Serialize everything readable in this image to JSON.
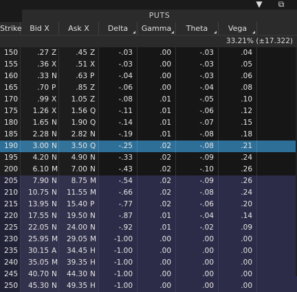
{
  "section_title": "PUTS",
  "headers": {
    "strike": "Strike",
    "bid": "Bid X",
    "ask": "Ask X",
    "delta": "Delta",
    "gamma": "Gamma",
    "theta": "Theta",
    "vega": "Vega"
  },
  "summary": "33.21% (±17.322)",
  "icons": {
    "dropdown": "layers-down-icon",
    "popout": "popout-window-icon"
  },
  "colors": {
    "itm_row": "#2d2c48",
    "selected_row": "#2d6f96",
    "otm_row": "#161616"
  },
  "rows": [
    {
      "strike": "150",
      "bid": ".27",
      "bidx": "Z",
      "ask": ".45",
      "askx": "Z",
      "delta": "-.03",
      "gamma": ".00",
      "theta": "-.03",
      "vega": ".04",
      "zone": "otm"
    },
    {
      "strike": "155",
      "bid": ".36",
      "bidx": "X",
      "ask": ".51",
      "askx": "X",
      "delta": "-.03",
      "gamma": ".00",
      "theta": "-.03",
      "vega": ".05",
      "zone": "otm"
    },
    {
      "strike": "160",
      "bid": ".33",
      "bidx": "N",
      "ask": ".63",
      "askx": "P",
      "delta": "-.04",
      "gamma": ".00",
      "theta": "-.03",
      "vega": ".06",
      "zone": "otm"
    },
    {
      "strike": "165",
      "bid": ".70",
      "bidx": "P",
      "ask": ".85",
      "askx": "Z",
      "delta": "-.06",
      "gamma": ".00",
      "theta": "-.04",
      "vega": ".08",
      "zone": "otm"
    },
    {
      "strike": "170",
      "bid": ".99",
      "bidx": "X",
      "ask": "1.05",
      "askx": "Z",
      "delta": "-.08",
      "gamma": ".01",
      "theta": "-.05",
      "vega": ".10",
      "zone": "otm"
    },
    {
      "strike": "175",
      "bid": "1.26",
      "bidx": "X",
      "ask": "1.56",
      "askx": "Q",
      "delta": "-.11",
      "gamma": ".01",
      "theta": "-.06",
      "vega": ".12",
      "zone": "otm"
    },
    {
      "strike": "180",
      "bid": "1.65",
      "bidx": "N",
      "ask": "1.90",
      "askx": "Q",
      "delta": "-.14",
      "gamma": ".01",
      "theta": "-.07",
      "vega": ".15",
      "zone": "otm"
    },
    {
      "strike": "185",
      "bid": "2.28",
      "bidx": "N",
      "ask": "2.82",
      "askx": "N",
      "delta": "-.19",
      "gamma": ".01",
      "theta": "-.08",
      "vega": ".18",
      "zone": "otm"
    },
    {
      "strike": "190",
      "bid": "3.00",
      "bidx": "N",
      "ask": "3.50",
      "askx": "Q",
      "delta": "-.25",
      "gamma": ".02",
      "theta": "-.08",
      "vega": ".21",
      "zone": "sel"
    },
    {
      "strike": "195",
      "bid": "4.20",
      "bidx": "N",
      "ask": "4.90",
      "askx": "N",
      "delta": "-.33",
      "gamma": ".02",
      "theta": "-.09",
      "vega": ".24",
      "zone": "otm"
    },
    {
      "strike": "200",
      "bid": "6.10",
      "bidx": "M",
      "ask": "7.00",
      "askx": "N",
      "delta": "-.43",
      "gamma": ".02",
      "theta": "-.10",
      "vega": ".26",
      "zone": "otm"
    },
    {
      "strike": "205",
      "bid": "7.90",
      "bidx": "N",
      "ask": "8.75",
      "askx": "M",
      "delta": "-.54",
      "gamma": ".02",
      "theta": "-.09",
      "vega": ".26",
      "zone": "itm"
    },
    {
      "strike": "210",
      "bid": "10.75",
      "bidx": "N",
      "ask": "11.55",
      "askx": "M",
      "delta": "-.66",
      "gamma": ".02",
      "theta": "-.08",
      "vega": ".24",
      "zone": "itm"
    },
    {
      "strike": "215",
      "bid": "13.95",
      "bidx": "N",
      "ask": "15.40",
      "askx": "P",
      "delta": "-.77",
      "gamma": ".02",
      "theta": "-.06",
      "vega": ".20",
      "zone": "itm"
    },
    {
      "strike": "220",
      "bid": "17.55",
      "bidx": "N",
      "ask": "19.50",
      "askx": "N",
      "delta": "-.87",
      "gamma": ".01",
      "theta": "-.04",
      "vega": ".14",
      "zone": "itm"
    },
    {
      "strike": "225",
      "bid": "22.05",
      "bidx": "N",
      "ask": "24.00",
      "askx": "N",
      "delta": "-.92",
      "gamma": ".01",
      "theta": "-.02",
      "vega": ".09",
      "zone": "itm"
    },
    {
      "strike": "230",
      "bid": "25.95",
      "bidx": "M",
      "ask": "29.05",
      "askx": "M",
      "delta": "-1.00",
      "gamma": ".00",
      "theta": ".00",
      "vega": ".00",
      "zone": "itm"
    },
    {
      "strike": "235",
      "bid": "30.15",
      "bidx": "A",
      "ask": "34.45",
      "askx": "H",
      "delta": "-1.00",
      "gamma": ".00",
      "theta": ".00",
      "vega": ".00",
      "zone": "itm"
    },
    {
      "strike": "240",
      "bid": "35.05",
      "bidx": "M",
      "ask": "39.35",
      "askx": "H",
      "delta": "-1.00",
      "gamma": ".00",
      "theta": ".00",
      "vega": ".00",
      "zone": "itm"
    },
    {
      "strike": "245",
      "bid": "40.70",
      "bidx": "N",
      "ask": "44.30",
      "askx": "N",
      "delta": "-1.00",
      "gamma": ".00",
      "theta": ".00",
      "vega": ".00",
      "zone": "itm"
    },
    {
      "strike": "250",
      "bid": "45.30",
      "bidx": "N",
      "ask": "49.35",
      "askx": "H",
      "delta": "-1.00",
      "gamma": ".00",
      "theta": ".00",
      "vega": ".00",
      "zone": "itm"
    }
  ]
}
